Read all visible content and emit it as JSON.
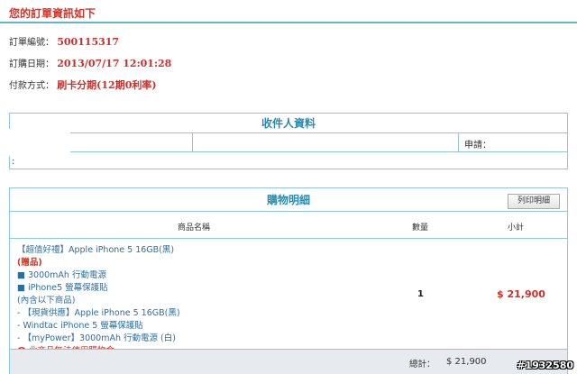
{
  "header": {
    "title": "您的訂單資訊如下"
  },
  "order": {
    "number_label": "訂單編號：",
    "number": "500115317",
    "date_label": "訂購日期：",
    "date": "2013/07/17 12:01:28",
    "payment_label": "付款方式：",
    "payment": "刷卡分期(12期0利率)"
  },
  "recipient": {
    "title": "收件人資料",
    "note_label": "申請：",
    "colon": ":"
  },
  "cart": {
    "title": "購物明細",
    "print_button": "列印明細",
    "col_name": "商品名稱",
    "col_qty": "數量",
    "col_subtotal": "小計",
    "item_lines": [
      "【超值好禮】Apple iPhone 5 16GB(黑)",
      "(贈品)",
      "■ 3000mAh 行動電源",
      "■ iPhone5 螢幕保護貼",
      "(內含以下商品)",
      "- 【現貨供應】Apple iPhone 5 16GB(黑)",
      "- Windtac iPhone 5 螢幕保護貼",
      "- 【myPower】3000mAh 行動電源 (白)",
      "此商品無法使用購物金"
    ],
    "qty": "1",
    "subtotal": "$ 21,900",
    "total_label": "總計：",
    "total_value": "$ 21,900"
  },
  "watermark": "#1932580",
  "colors": {
    "accent": "#5eb6cf",
    "red": "#c9302c",
    "link": "#2d6ea0"
  }
}
